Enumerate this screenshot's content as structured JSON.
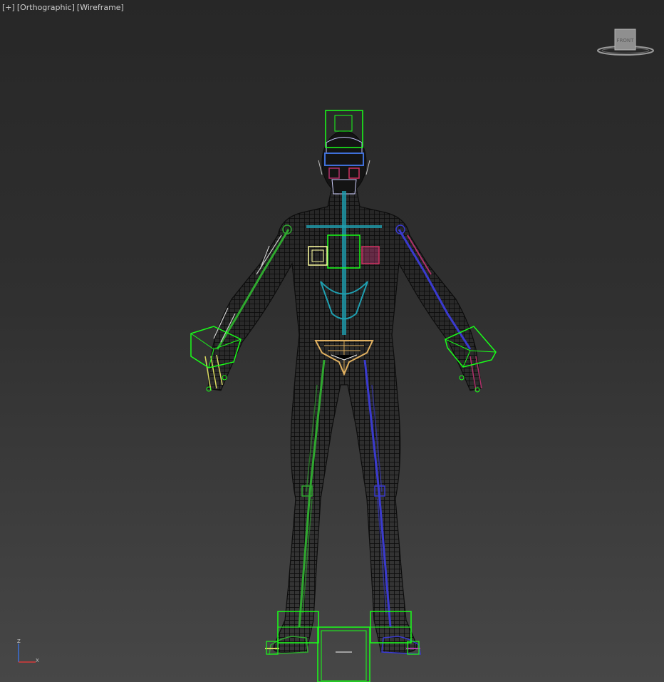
{
  "viewport": {
    "menu_plus": "[+]",
    "view_mode": "[Orthographic]",
    "shading_mode": "[Wireframe]"
  },
  "viewcube": {
    "face_label": "FRONT"
  },
  "axis_tripod": {
    "z": "Z",
    "x": "X"
  },
  "colors": {
    "rig_green": "#19ff19",
    "mesh_wire": "#101010",
    "right_side": "#3a3acf",
    "left_side": "#2fa82f",
    "spine": "#1f9fb0",
    "pelvis": "#e0b060",
    "right_arm": "#b0306a",
    "background_top": "#272727",
    "background_bottom": "#474747"
  }
}
